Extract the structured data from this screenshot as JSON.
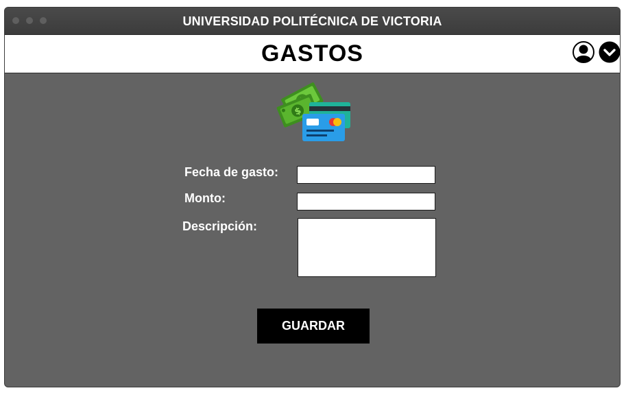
{
  "window": {
    "title": "UNIVERSIDAD POLITÉCNICA DE VICTORIA"
  },
  "header": {
    "title": "GASTOS",
    "icons": [
      "user-icon",
      "chevron-down-icon"
    ]
  },
  "illustration": {
    "icons": [
      "money-bills-icon",
      "credit-cards-icon"
    ]
  },
  "form": {
    "fecha": {
      "label": "Fecha de gasto:",
      "value": ""
    },
    "monto": {
      "label": "Monto:",
      "value": ""
    },
    "descripcion": {
      "label": "Descripción:",
      "value": ""
    },
    "save_label": "GUARDAR"
  },
  "colors": {
    "titlebar": "#3f3f3f",
    "content_background": "#636363",
    "button_background": "#000000",
    "money_green": "#4caf27",
    "card_blue": "#2a9de8",
    "card_teal": "#1fb39a"
  }
}
